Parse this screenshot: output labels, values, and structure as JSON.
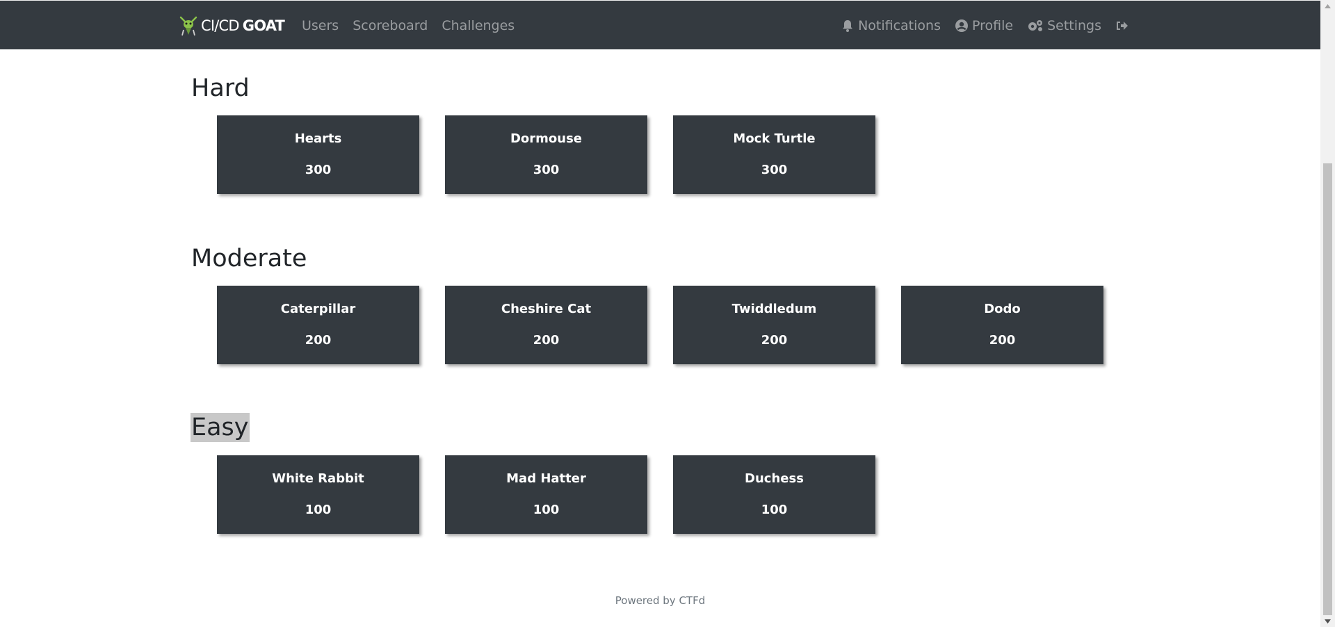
{
  "brand": {
    "prefix": "CI/CD",
    "suffix": "GOAT"
  },
  "nav_left": [
    {
      "label": "Users"
    },
    {
      "label": "Scoreboard"
    },
    {
      "label": "Challenges"
    }
  ],
  "nav_right": {
    "notifications": "Notifications",
    "profile": "Profile",
    "settings": "Settings"
  },
  "categories": [
    {
      "title": "Hard",
      "challenges": [
        {
          "name": "Hearts",
          "value": "300"
        },
        {
          "name": "Dormouse",
          "value": "300"
        },
        {
          "name": "Mock Turtle",
          "value": "300"
        }
      ]
    },
    {
      "title": "Moderate",
      "challenges": [
        {
          "name": "Caterpillar",
          "value": "200"
        },
        {
          "name": "Cheshire Cat",
          "value": "200"
        },
        {
          "name": "Twiddledum",
          "value": "200"
        },
        {
          "name": "Dodo",
          "value": "200"
        }
      ]
    },
    {
      "title": "Easy",
      "challenges": [
        {
          "name": "White Rabbit",
          "value": "100"
        },
        {
          "name": "Mad Hatter",
          "value": "100"
        },
        {
          "name": "Duchess",
          "value": "100"
        }
      ]
    }
  ],
  "footer": {
    "text": "Powered by CTFd"
  },
  "colors": {
    "navbar": "#343a40",
    "card": "#343a40",
    "nav_text": "#9a9da0",
    "highlight": "#c8c8c8"
  }
}
